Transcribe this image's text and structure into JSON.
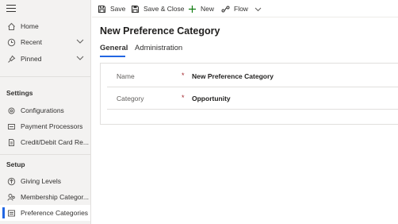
{
  "sidebar": {
    "top": [
      {
        "label": "Home",
        "icon": "home-icon"
      },
      {
        "label": "Recent",
        "icon": "clock-icon"
      },
      {
        "label": "Pinned",
        "icon": "pin-icon"
      }
    ],
    "settings_title": "Settings",
    "settings": [
      {
        "label": "Configurations",
        "icon": "settings-icon"
      },
      {
        "label": "Payment Processors",
        "icon": "payment-processor-icon"
      },
      {
        "label": "Credit/Debit Card Re...",
        "icon": "document-icon"
      }
    ],
    "setup_title": "Setup",
    "setup": [
      {
        "label": "Giving Levels",
        "icon": "level-up-icon"
      },
      {
        "label": "Membership Categor...",
        "icon": "people-icon"
      },
      {
        "label": "Preference Categories",
        "icon": "list-icon"
      }
    ]
  },
  "toolbar": {
    "save": "Save",
    "save_close": "Save & Close",
    "new": "New",
    "flow": "Flow"
  },
  "form": {
    "title": "New Preference Category",
    "tabs": [
      "General",
      "Administration"
    ],
    "fields": [
      {
        "label": "Name",
        "required": "*",
        "value": "New Preference Category"
      },
      {
        "label": "Category",
        "required": "*",
        "value": "Opportunity"
      }
    ]
  },
  "colors": {
    "accent": "#2266e3",
    "required": "#a4262c",
    "sidebar_bg": "#f3f2f1"
  }
}
